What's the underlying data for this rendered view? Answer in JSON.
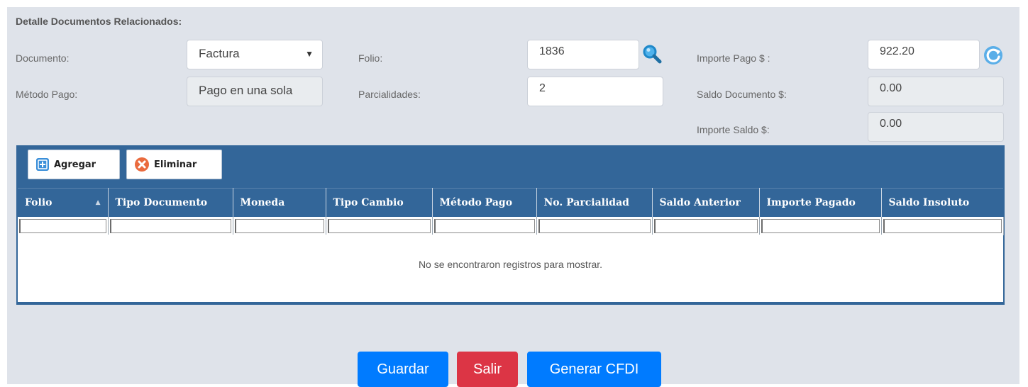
{
  "section": {
    "title": "Detalle Documentos Relacionados:"
  },
  "form": {
    "documento": {
      "label": "Documento:",
      "value": "Factura",
      "arrow": "▼"
    },
    "metodo_pago": {
      "label": "Método Pago:",
      "value": "Pago en una sola"
    },
    "folio": {
      "label": "Folio:",
      "value": "1836",
      "icon": "search-icon"
    },
    "parcialidades": {
      "label": "Parcialidades:",
      "value": "2"
    },
    "importe_pago": {
      "label": "Importe Pago $ :",
      "value": "922.20",
      "icon": "refresh-icon"
    },
    "saldo_documento": {
      "label": "Saldo Documento $:",
      "value": "0.00"
    },
    "importe_saldo": {
      "label": "Importe Saldo $:",
      "value": "0.00"
    }
  },
  "grid": {
    "toolbar": {
      "add_label": "Agregar",
      "add_icon": "plus-icon",
      "delete_label": "Eliminar",
      "delete_icon": "close-icon"
    },
    "columns": [
      "Folio",
      "Tipo Documento",
      "Moneda",
      "Tipo Cambio",
      "Método Pago",
      "No. Parcialidad",
      "Saldo Anterior",
      "Importe Pagado",
      "Saldo Insoluto"
    ],
    "sort_indicator": "▲",
    "empty_message": "No se encontraron registros para mostrar."
  },
  "actions": {
    "save": "Guardar",
    "exit": "Salir",
    "generate": "Generar CFDI"
  },
  "colors": {
    "panel_bg": "#dfe3ea",
    "grid_header": "#336699",
    "primary": "#007bff",
    "danger": "#dc3545"
  }
}
